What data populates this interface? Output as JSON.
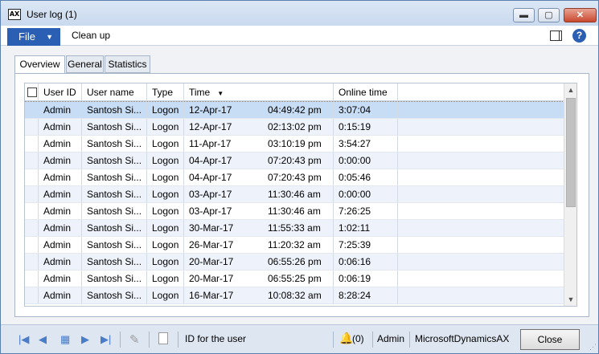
{
  "window": {
    "title": "User log (1)",
    "icon_text": "AX",
    "minimize_glyph": "▬",
    "maximize_glyph": "▢",
    "close_glyph": "✕"
  },
  "menu": {
    "file_label": "File",
    "file_caret": "▼",
    "cleanup_label": "Clean up",
    "help_glyph": "?"
  },
  "tabs": [
    {
      "label": "Overview",
      "active": true
    },
    {
      "label": "General",
      "active": false
    },
    {
      "label": "Statistics",
      "active": false
    }
  ],
  "grid": {
    "columns": {
      "user_id": "User ID",
      "user_name": "User name",
      "type": "Type",
      "time": "Time",
      "online_time": "Online time"
    },
    "sort_caret": "▼",
    "rows": [
      {
        "user_id": "Admin",
        "user_name": "Santosh Si...",
        "type": "Logon",
        "date": "12-Apr-17",
        "time": "04:49:42 pm",
        "online": "3:07:04",
        "selected": true
      },
      {
        "user_id": "Admin",
        "user_name": "Santosh Si...",
        "type": "Logon",
        "date": "12-Apr-17",
        "time": "02:13:02 pm",
        "online": "0:15:19"
      },
      {
        "user_id": "Admin",
        "user_name": "Santosh Si...",
        "type": "Logon",
        "date": "11-Apr-17",
        "time": "03:10:19 pm",
        "online": "3:54:27"
      },
      {
        "user_id": "Admin",
        "user_name": "Santosh Si...",
        "type": "Logon",
        "date": "04-Apr-17",
        "time": "07:20:43 pm",
        "online": "0:00:00"
      },
      {
        "user_id": "Admin",
        "user_name": "Santosh Si...",
        "type": "Logon",
        "date": "04-Apr-17",
        "time": "07:20:43 pm",
        "online": "0:05:46"
      },
      {
        "user_id": "Admin",
        "user_name": "Santosh Si...",
        "type": "Logon",
        "date": "03-Apr-17",
        "time": "11:30:46 am",
        "online": "0:00:00"
      },
      {
        "user_id": "Admin",
        "user_name": "Santosh Si...",
        "type": "Logon",
        "date": "03-Apr-17",
        "time": "11:30:46 am",
        "online": "7:26:25"
      },
      {
        "user_id": "Admin",
        "user_name": "Santosh Si...",
        "type": "Logon",
        "date": "30-Mar-17",
        "time": "11:55:33 am",
        "online": "1:02:11"
      },
      {
        "user_id": "Admin",
        "user_name": "Santosh Si...",
        "type": "Logon",
        "date": "26-Mar-17",
        "time": "11:20:32 am",
        "online": "7:25:39"
      },
      {
        "user_id": "Admin",
        "user_name": "Santosh Si...",
        "type": "Logon",
        "date": "20-Mar-17",
        "time": "06:55:26 pm",
        "online": "0:06:16"
      },
      {
        "user_id": "Admin",
        "user_name": "Santosh Si...",
        "type": "Logon",
        "date": "20-Mar-17",
        "time": "06:55:25 pm",
        "online": "0:06:19"
      },
      {
        "user_id": "Admin",
        "user_name": "Santosh Si...",
        "type": "Logon",
        "date": "16-Mar-17",
        "time": "10:08:32 am",
        "online": "8:28:24"
      }
    ],
    "scroll_up_glyph": "▲",
    "scroll_down_glyph": "▼"
  },
  "statusbar": {
    "nav_first": "|◀",
    "nav_prev": "◀",
    "nav_list": "▦",
    "nav_next": "▶",
    "nav_last": "▶|",
    "pencil_glyph": "✎",
    "text": "ID for the user",
    "bell_glyph": "🔔",
    "notification_count": "(0)",
    "user": "Admin",
    "company": "MicrosoftDynamicsAX",
    "close_label": "Close",
    "resize_glyph": "⋰"
  },
  "colors": {
    "file_menu_bg": "#2b5fb3",
    "selected_row": "#c7ddf5",
    "alt_row": "#eef3fb",
    "statusbar_bg": "#dde6f1"
  }
}
